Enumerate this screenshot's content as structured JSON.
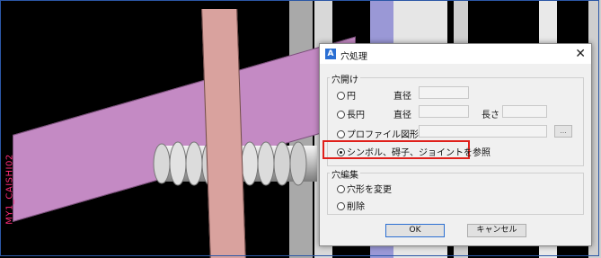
{
  "viewport": {
    "side_label": "MY1_CAISHI02"
  },
  "dialog": {
    "title": "穴処理",
    "close_glyph": "✕",
    "app_icon": "app-logo-icon",
    "section_hole": {
      "label": "穴開け",
      "circle": {
        "label": "円",
        "diameter_label": "直径",
        "diameter_value": ""
      },
      "slot": {
        "label": "長円",
        "diameter_label": "直径",
        "diameter_value": "",
        "length_label": "長さ",
        "length_value": ""
      },
      "profile": {
        "label": "プロファイル図形",
        "value": "",
        "browse_label": "..."
      },
      "symbol": {
        "label": "シンボル、碍子、ジョイントを参照",
        "selected": true
      }
    },
    "section_edit": {
      "label": "穴編集",
      "change_shape": {
        "label": "穴形を変更"
      },
      "delete": {
        "label": "削除"
      }
    },
    "buttons": {
      "ok": "OK",
      "cancel": "キャンセル"
    }
  },
  "colors": {
    "highlight_box": "#e0201b",
    "accent": "#2b6fd3"
  }
}
